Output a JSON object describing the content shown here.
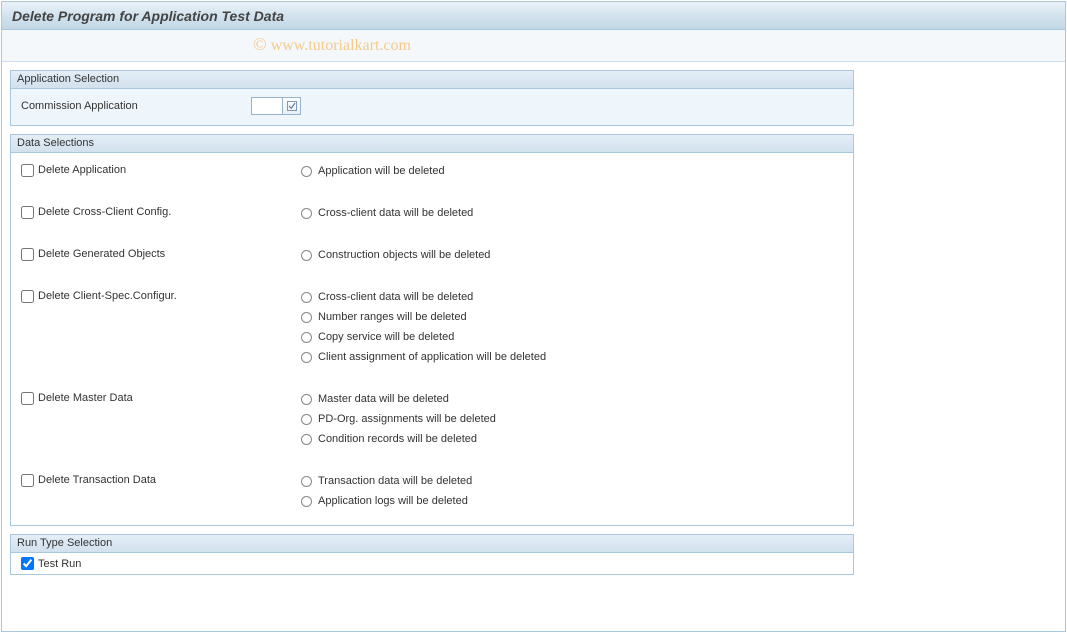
{
  "title": "Delete Program for Application Test Data",
  "watermark": "© www.tutorialkart.com",
  "groups": {
    "app_selection": {
      "header": "Application Selection",
      "field_label": "Commission Application",
      "field_value": ""
    },
    "data_selections": {
      "header": "Data Selections",
      "rows": [
        {
          "label": "Delete Application",
          "checked": false,
          "descs": [
            "Application will be deleted"
          ]
        },
        {
          "label": "Delete Cross-Client Config.",
          "checked": false,
          "descs": [
            "Cross-client data will be deleted"
          ]
        },
        {
          "label": "Delete Generated Objects",
          "checked": false,
          "descs": [
            "Construction objects will be deleted"
          ]
        },
        {
          "label": "Delete Client-Spec.Configur.",
          "checked": false,
          "descs": [
            "Cross-client data will be deleted",
            "Number ranges will be deleted",
            "Copy service will be deleted",
            "Client assignment of application will be deleted"
          ]
        },
        {
          "label": "Delete Master Data",
          "checked": false,
          "descs": [
            "Master data will be deleted",
            "PD-Org. assignments will be deleted",
            "Condition records will be deleted"
          ]
        },
        {
          "label": "Delete Transaction Data",
          "checked": false,
          "descs": [
            "Transaction data will be deleted",
            "Application logs will be deleted"
          ]
        }
      ]
    },
    "run_type": {
      "header": "Run Type Selection",
      "label": "Test Run",
      "checked": true
    }
  }
}
